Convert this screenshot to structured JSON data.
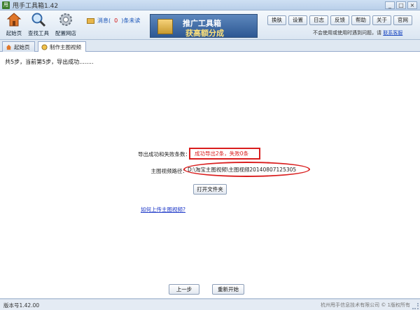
{
  "window": {
    "app_icon_text": "甩",
    "title": "甩手工具箱1.42",
    "controls": [
      "_",
      "□",
      "×"
    ]
  },
  "toolbar": {
    "tools": [
      {
        "label": "起始页",
        "icon": "home-icon"
      },
      {
        "label": "查找工具",
        "icon": "search-icon"
      },
      {
        "label": "配置网店",
        "icon": "gear-icon"
      }
    ],
    "message": {
      "prefix": "消息(",
      "count": "0",
      "suffix": ")条未读"
    },
    "banner": {
      "line1": "推广工具箱",
      "line2": "获高额分成"
    },
    "buttons": [
      "换肤",
      "设置",
      "日志",
      "反馈",
      "帮助",
      "关于",
      "官网"
    ],
    "notice": {
      "text": "不会使用或使用时遇到问题，请",
      "link": "联系客服"
    }
  },
  "tabs": [
    {
      "label": "起始页",
      "icon": "home-tab-icon",
      "active": false
    },
    {
      "label": "制作主图视频",
      "icon": "video-tab-icon",
      "active": true
    }
  ],
  "main": {
    "step_status": "共5步，当前第5步，导出成功........",
    "result_label": "导出成功和失败条数：",
    "result_value": "成功导出2条，失败0条",
    "path_label": "主图视频路径：",
    "path_value": "D:\\淘宝主图视频\\主图视频20140807125305",
    "open_folder_button": "打开文件夹",
    "help_link": "如何上传主图视频?",
    "prev_button": "上一步",
    "restart_button": "重新开始"
  },
  "status": {
    "version": "版本号1.42.00",
    "copyright": "杭州甩手信息技术有限公司 © 1版权所有"
  },
  "colors": {
    "highlight": "#d91d1d",
    "link": "#1a47c0"
  }
}
